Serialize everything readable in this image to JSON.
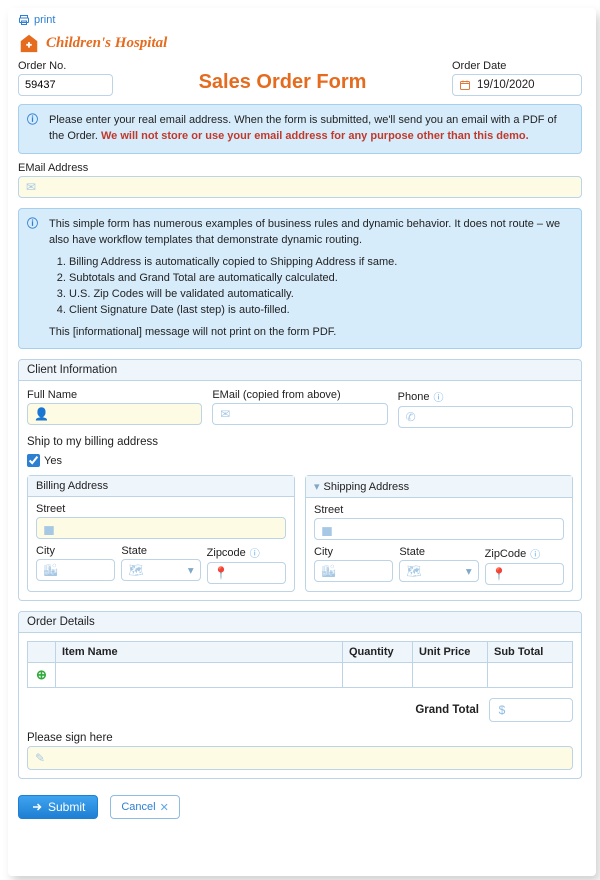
{
  "print_label": "print",
  "logo_text": "Children's Hospital",
  "header": {
    "order_no_label": "Order No.",
    "order_no_value": "59437",
    "title": "Sales Order Form",
    "order_date_label": "Order Date",
    "order_date_value": "19/10/2020"
  },
  "notice_email": {
    "lead": "Please enter your real email address. When the form is submitted, we'll send you an email with a PDF of the Order. ",
    "warn": "We will not store or use your email address for any purpose other than this demo."
  },
  "email_label": "EMail Address",
  "rules_callout": {
    "intro": "This simple form has numerous examples of business rules and dynamic behavior. It does not route – we also have workflow templates that demonstrate dynamic routing.",
    "items": [
      "Billing Address is automatically copied to Shipping Address if same.",
      "Subtotals and Grand Total are automatically calculated.",
      "U.S. Zip Codes will be validated automatically.",
      "Client Signature Date (last step) is auto-filled."
    ],
    "outro": "This [informational] message will not print on the form PDF."
  },
  "client": {
    "section": "Client Information",
    "full_name_label": "Full Name",
    "email_label": "EMail (copied from above)",
    "phone_label": "Phone",
    "ship_same_label": "Ship to my billing address",
    "yes_label": "Yes",
    "billing_h": "Billing Address",
    "shipping_h": "Shipping Address",
    "street_label": "Street",
    "city_label": "City",
    "state_label": "State",
    "zip_label_b": "Zipcode",
    "zip_label_s": "ZipCode"
  },
  "order": {
    "section": "Order Details",
    "cols": {
      "item": "Item Name",
      "qty": "Quantity",
      "unit": "Unit Price",
      "sub": "Sub Total"
    },
    "grand_total_label": "Grand Total",
    "sign_label": "Please sign here"
  },
  "buttons": {
    "submit": "Submit",
    "cancel": "Cancel"
  }
}
